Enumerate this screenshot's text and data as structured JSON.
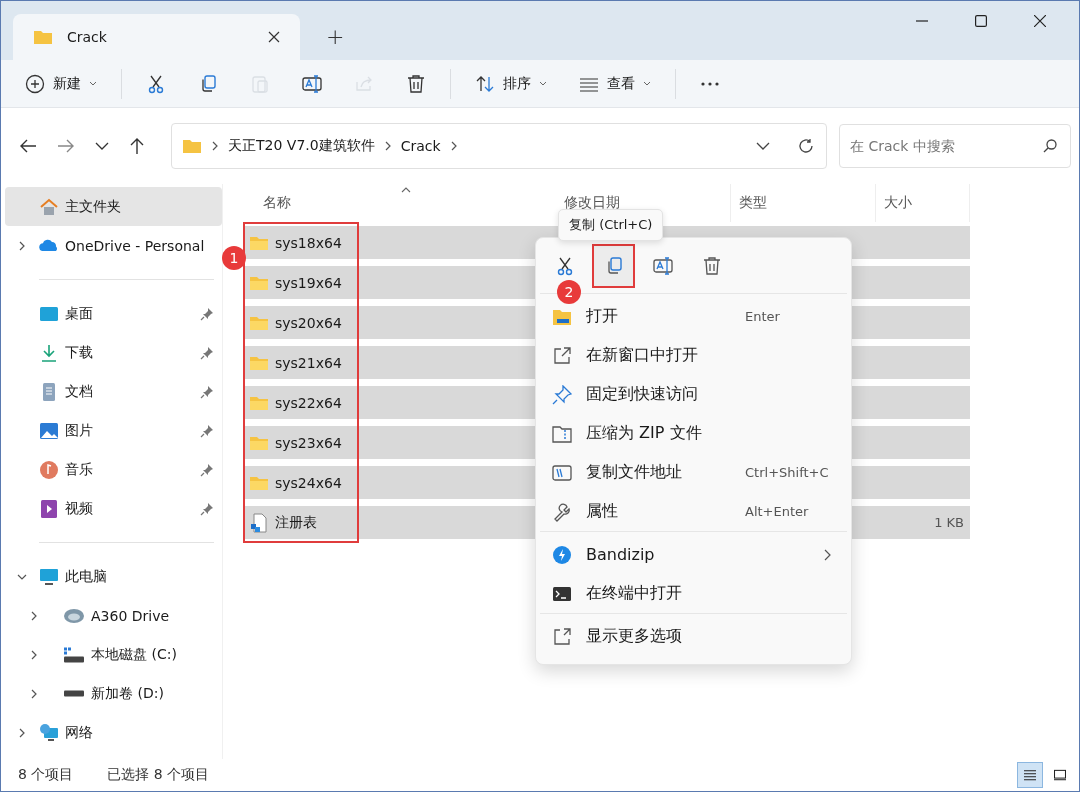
{
  "tab": {
    "title": "Crack",
    "add": "+"
  },
  "toolbar": [
    {
      "kind": "new",
      "label": "新建",
      "disabled": false
    },
    {
      "kind": "cut",
      "disabled": false
    },
    {
      "kind": "copy",
      "disabled": false
    },
    {
      "kind": "paste",
      "disabled": true
    },
    {
      "kind": "rename",
      "disabled": false
    },
    {
      "kind": "share",
      "disabled": true
    },
    {
      "kind": "delete",
      "disabled": false
    },
    {
      "kind": "sort",
      "label": "排序",
      "disabled": false
    },
    {
      "kind": "view",
      "label": "查看",
      "disabled": false
    },
    {
      "kind": "more",
      "disabled": false
    }
  ],
  "address": {
    "segments": [
      "天正T20 V7.0建筑软件",
      "Crack"
    ]
  },
  "search": {
    "placeholder": "在 Crack 中搜索"
  },
  "sidebar": [
    [
      {
        "kind": "home",
        "label": "主文件夹",
        "selected": true,
        "pinned": false
      },
      {
        "kind": "onedrive",
        "label": "OneDrive - Personal",
        "selected": false,
        "pinned": false,
        "expanded": false
      }
    ],
    [
      {
        "kind": "desktop",
        "label": "桌面",
        "selected": false,
        "pinned": true
      },
      {
        "kind": "download",
        "label": "下载",
        "selected": false,
        "pinned": true
      },
      {
        "kind": "document",
        "label": "文档",
        "selected": false,
        "pinned": true
      },
      {
        "kind": "picture",
        "label": "图片",
        "selected": false,
        "pinned": true
      },
      {
        "kind": "music",
        "label": "音乐",
        "selected": false,
        "pinned": true
      },
      {
        "kind": "video",
        "label": "视频",
        "selected": false,
        "pinned": true
      }
    ],
    [
      {
        "kind": "pc",
        "label": "此电脑",
        "selected": false,
        "pinned": false,
        "expanded": true,
        "children": [
          {
            "kind": "cloud",
            "label": "A360 Drive",
            "selected": false,
            "expanded": false
          },
          {
            "kind": "system-drive",
            "label": "本地磁盘 (C:)",
            "selected": false,
            "expanded": false
          },
          {
            "kind": "drive",
            "label": "新加卷 (D:)",
            "selected": false,
            "expanded": false
          }
        ]
      },
      {
        "kind": "network",
        "label": "网络",
        "selected": false,
        "pinned": false,
        "expanded": false
      }
    ]
  ],
  "columns": [
    "名称",
    "修改日期",
    "类型",
    "大小"
  ],
  "rows": [
    {
      "name": "sys18x64",
      "kind": "folder",
      "selected": true
    },
    {
      "name": "sys19x64",
      "kind": "folder",
      "selected": true
    },
    {
      "name": "sys20x64",
      "kind": "folder",
      "selected": true
    },
    {
      "name": "sys21x64",
      "kind": "folder",
      "selected": true
    },
    {
      "name": "sys22x64",
      "kind": "folder",
      "selected": true
    },
    {
      "name": "sys23x64",
      "kind": "folder",
      "selected": true
    },
    {
      "name": "sys24x64",
      "kind": "folder",
      "selected": true
    },
    {
      "name": "注册表",
      "kind": "registry",
      "selected": true,
      "size": "1 KB"
    }
  ],
  "context_menu": {
    "tooltip": "复制 (Ctrl+C)",
    "quick_actions": [
      {
        "kind": "cut",
        "outlined": false
      },
      {
        "kind": "copy",
        "outlined": true
      },
      {
        "kind": "rename",
        "outlined": false
      },
      {
        "kind": "delete",
        "outlined": false
      }
    ],
    "groups": [
      [
        {
          "kind": "open",
          "label": "打开",
          "shortcut": "Enter"
        },
        {
          "kind": "new-window",
          "label": "在新窗口中打开"
        },
        {
          "kind": "pin",
          "label": "固定到快速访问"
        },
        {
          "kind": "zip",
          "label": "压缩为 ZIP 文件"
        },
        {
          "kind": "copy-path",
          "label": "复制文件地址",
          "shortcut": "Ctrl+Shift+C"
        },
        {
          "kind": "properties",
          "label": "属性",
          "shortcut": "Alt+Enter"
        }
      ],
      [
        {
          "kind": "bandizip",
          "label": "Bandizip",
          "submenu": true
        },
        {
          "kind": "terminal",
          "label": "在终端中打开"
        }
      ],
      [
        {
          "kind": "more",
          "label": "显示更多选项"
        }
      ]
    ]
  },
  "annotations": [
    {
      "label": "1"
    },
    {
      "label": "2"
    }
  ],
  "status_bar": {
    "count": "8 个项目",
    "selection": "已选择 8 个项目",
    "views": [
      {
        "kind": "details",
        "selected": true
      },
      {
        "kind": "tiles",
        "selected": false
      }
    ]
  }
}
